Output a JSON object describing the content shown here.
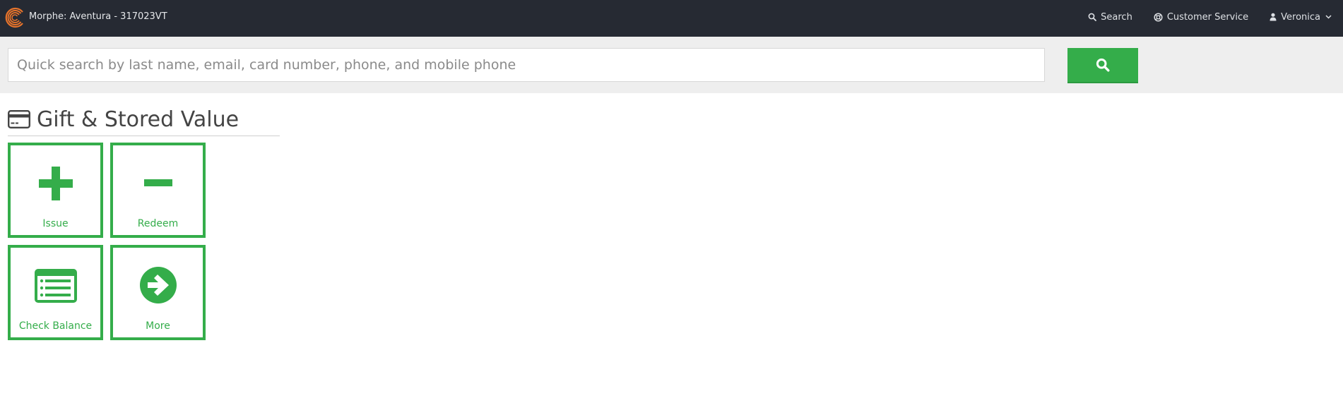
{
  "app": {
    "title": "Morphe: Aventura - 317023VT",
    "logo_icon": "c-logo-icon",
    "brand_color": "#e8742b"
  },
  "nav": {
    "search_label": "Search",
    "search_icon": "search-icon",
    "service_label": "Customer Service",
    "service_icon": "lifebuoy-icon",
    "user_label": "Veronica",
    "user_icon": "user-icon",
    "user_menu_icon": "chevron-down-icon"
  },
  "search": {
    "placeholder": "Quick search by last name, email, card number, phone, and mobile phone",
    "value": "",
    "button_icon": "search-icon"
  },
  "section": {
    "title": "Gift & Stored Value",
    "icon": "credit-card-icon"
  },
  "tiles": [
    {
      "label": "Issue",
      "icon": "plus-icon"
    },
    {
      "label": "Redeem",
      "icon": "minus-icon"
    },
    {
      "label": "Check Balance",
      "icon": "list-icon"
    },
    {
      "label": "More",
      "icon": "arrow-circle-right-icon"
    }
  ],
  "colors": {
    "topbar_bg": "#262a33",
    "accent_green": "#34ad4a",
    "search_band_bg": "#eeeeee"
  }
}
